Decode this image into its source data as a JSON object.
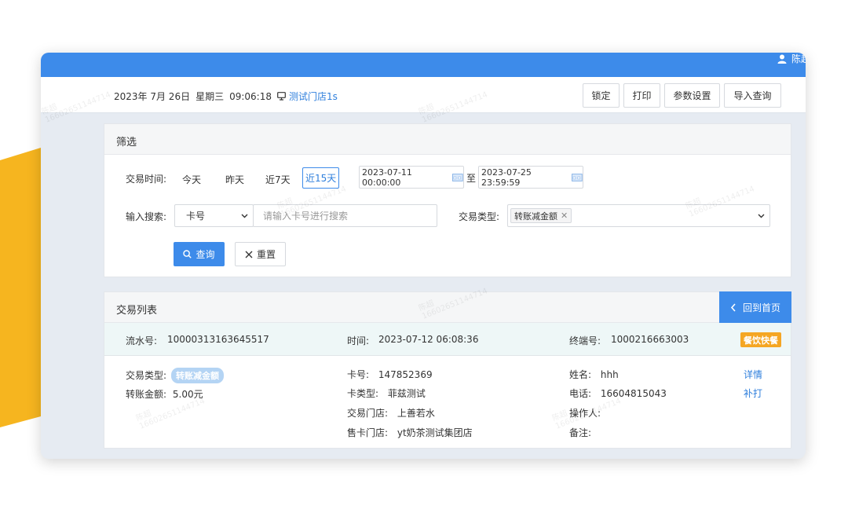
{
  "colors": {
    "accent": "#3d8bea",
    "deco": "#f6b51f",
    "badge_orange": "#f5a623",
    "badge_blue": "#b4d4f4"
  },
  "topbar": {
    "user_name": "陈超",
    "user_icon": "user-icon"
  },
  "infobar": {
    "date": "2023年 7月 26日",
    "weekday": "星期三",
    "time": "09:06:18",
    "store_name": "测试门店1s",
    "store_icon": "monitor-icon",
    "buttons": {
      "lock": "锁定",
      "print": "打印",
      "settings": "参数设置",
      "import_query": "导入查询"
    }
  },
  "filter": {
    "title": "筛选",
    "time_label": "交易时间:",
    "quick": {
      "today": "今天",
      "yesterday": "昨天",
      "last7": "近7天",
      "last15": "近15天"
    },
    "start_date": "2023-07-11 00:00:00",
    "to": "至",
    "end_date": "2023-07-25 23:59:59",
    "search_label": "输入搜索:",
    "search_field": "卡号",
    "search_placeholder": "请输入卡号进行搜索",
    "type_label": "交易类型:",
    "type_tag": "转账减金额",
    "query_button": "查询",
    "reset_button": "重置"
  },
  "list": {
    "title": "交易列表",
    "back_button": "回到首页",
    "record": {
      "serial_label": "流水号:",
      "serial": "10000313163645517",
      "time_label": "时间:",
      "time": "2023-07-12 06:08:36",
      "terminal_label": "终端号:",
      "terminal": "1000216663003",
      "tag": "餐饮快餐",
      "type_label": "交易类型:",
      "type": "转账减金额",
      "amount_label": "转账金额:",
      "amount": "5.00元",
      "card_label": "卡号:",
      "card": "147852369",
      "card_type_label": "卡类型:",
      "card_type": "菲兹测试",
      "trade_store_label": "交易门店:",
      "trade_store": "上善若水",
      "sell_store_label": "售卡门店:",
      "sell_store": "yt奶茶测试集团店",
      "name_label": "姓名:",
      "name": "hhh",
      "phone_label": "电话:",
      "phone": "16604815043",
      "operator_label": "操作人:",
      "remark_label": "备注:",
      "detail_link": "详情",
      "reprint_link": "补打"
    }
  },
  "watermark": {
    "name": "陈超",
    "number": "16602651144714"
  }
}
